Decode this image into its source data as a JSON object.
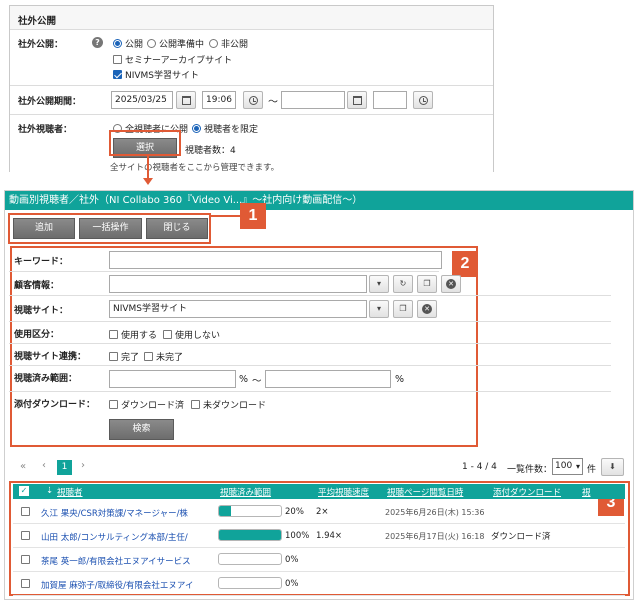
{
  "top": {
    "title": "社外公開",
    "publish_label": "社外公開：",
    "publish_options": [
      "公開",
      "公開準備中",
      "非公開"
    ],
    "publish_selected": 0,
    "archive_sites": [
      {
        "label": "セミナーアーカイブサイト",
        "checked": false
      },
      {
        "label": "NIVMS学習サイト",
        "checked": true
      }
    ],
    "period_label": "社外公開期間：",
    "period_start_date": "2025/03/25",
    "period_start_time": "19:06",
    "period_sep": "～",
    "period_end_date": "",
    "period_end_time": "",
    "viewer_label": "社外視聴者：",
    "viewer_options": [
      "全視聴者に公開",
      "視聴者を限定"
    ],
    "viewer_selected": 1,
    "select_button": "選択",
    "viewer_count": "視聴者数：4",
    "manage_note": "全サイトの視聴者をここから管理できます。"
  },
  "modal": {
    "title": "動画別視聴者／社外（NI Collabo 360『Video Vi...』～社内向け動画配信～）",
    "buttons": [
      "追加",
      "一括操作",
      "閉じる"
    ],
    "badges": [
      "1",
      "2",
      "3"
    ]
  },
  "filter": {
    "keyword_label": "キーワード：",
    "keyword_value": "",
    "customer_label": "顧客情報：",
    "customer_value": "",
    "site_label": "視聴サイト：",
    "site_value": "NIVMS学習サイト",
    "usage_label": "使用区分：",
    "usage_options": [
      "使用する",
      "使用しない"
    ],
    "link_label": "視聴サイト連携：",
    "link_options": [
      "完了",
      "未完了"
    ],
    "range_label": "視聴済み範囲：",
    "range_from": "",
    "range_unit": "%",
    "range_sep": "～",
    "range_to": "",
    "download_label": "添付ダウンロード：",
    "download_options": [
      "ダウンロード済",
      "未ダウンロード"
    ],
    "search_button": "検索"
  },
  "pagination": {
    "first": "«",
    "prev": "‹",
    "current": "1",
    "next": "›",
    "range_text": "1 - 4 / 4",
    "per_page_label": "一覧件数：",
    "per_page_value": "100",
    "per_page_unit": "件"
  },
  "table": {
    "check_header": "✓",
    "columns": [
      "視聴者",
      "視聴済み範囲",
      "平均視聴速度",
      "視聴ページ閲覧日時",
      "添付ダウンロード",
      "視"
    ],
    "rows": [
      {
        "name": "久江 果央/CSR対策課/マネージャー/株",
        "progress": 20,
        "pct": "20%",
        "speed": "2×",
        "date": "2025年6月26日(木) 15:36",
        "download": ""
      },
      {
        "name": "山田 太郎/コンサルティング本部/主任/",
        "progress": 100,
        "pct": "100%",
        "speed": "1.94×",
        "date": "2025年6月17日(火) 16:18",
        "download": "ダウンロード済"
      },
      {
        "name": "茶尾 英一郎/有限会社エヌアイサービス",
        "progress": 0,
        "pct": "0%",
        "speed": "",
        "date": "",
        "download": ""
      },
      {
        "name": "加賀屋 麻弥子/取締役/有限会社エヌアイ",
        "progress": 0,
        "pct": "0%",
        "speed": "",
        "date": "",
        "download": ""
      }
    ]
  },
  "colors": {
    "teal": "#10a39a",
    "accent": "#e05a35",
    "link": "#1a4fb0"
  }
}
